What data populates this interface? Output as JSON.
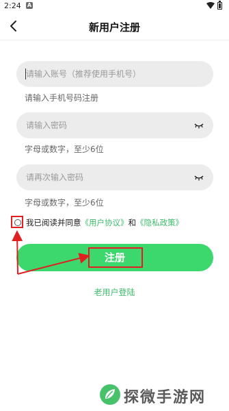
{
  "status_bar": {
    "time": "2:24",
    "notification_badge": "A",
    "icons": [
      "wifi-icon",
      "battery-icon"
    ]
  },
  "header": {
    "title": "新用户注册",
    "back_icon": "chevron-left-icon"
  },
  "form": {
    "account": {
      "placeholder": "请输入账号（推荐使用手机号）",
      "hint": "请输入手机号码注册"
    },
    "password": {
      "placeholder": "请输入密码",
      "hint": "字母或数字，至少6位",
      "icon": "eye-closed-icon"
    },
    "confirm_password": {
      "placeholder": "请再次输入密码",
      "hint": "字母或数字，至少6位",
      "icon": "eye-closed-icon"
    }
  },
  "agreement": {
    "prefix": "我已阅读并同意",
    "user_agreement": "《用户协议》",
    "conjunction": "和",
    "privacy_policy": "《隐私政策》",
    "checked": false
  },
  "register_button": {
    "label": "注册"
  },
  "old_user_login": "老用户登陆",
  "watermark": {
    "text": "探微手游网"
  },
  "colors": {
    "accent": "#3cd86e",
    "link": "#3dbb6b",
    "annotation": "#e02020",
    "field_bg": "#ececec"
  }
}
